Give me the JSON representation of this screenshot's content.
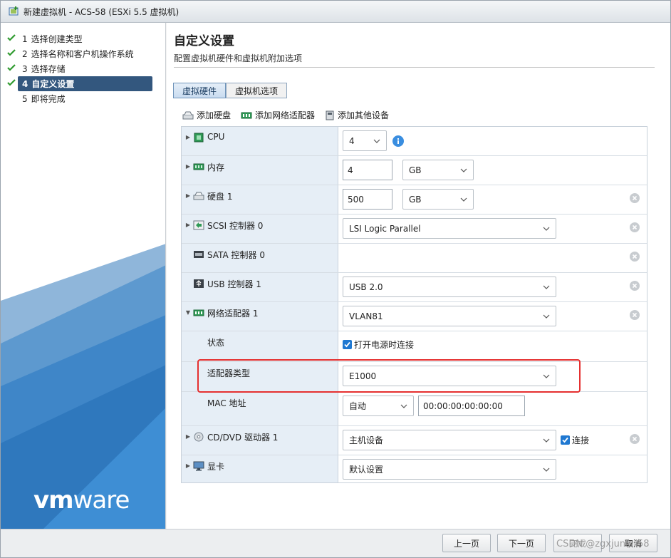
{
  "window": {
    "title": "新建虚拟机 - ACS-58 (ESXi 5.5 虚拟机)"
  },
  "steps": [
    {
      "num": "1",
      "label": "选择创建类型",
      "done": true
    },
    {
      "num": "2",
      "label": "选择名称和客户机操作系统",
      "done": true
    },
    {
      "num": "3",
      "label": "选择存储",
      "done": true
    },
    {
      "num": "4",
      "label": "自定义设置",
      "done": true,
      "active": true
    },
    {
      "num": "5",
      "label": "即将完成",
      "done": false
    }
  ],
  "brand": {
    "logo_vm": "vm",
    "logo_ware": "ware"
  },
  "main": {
    "title": "自定义设置",
    "subtitle": "配置虚拟机硬件和虚拟机附加选项",
    "tabs": [
      {
        "label": "虚拟硬件",
        "active": true
      },
      {
        "label": "虚拟机选项",
        "active": false
      }
    ],
    "toolbar": {
      "add_disk": "添加硬盘",
      "add_nic": "添加网络适配器",
      "add_other": "添加其他设备"
    }
  },
  "hardware": {
    "cpu": {
      "label": "CPU",
      "value": "4"
    },
    "memory": {
      "label": "内存",
      "value": "4",
      "unit": "GB"
    },
    "disk": {
      "label": "硬盘 1",
      "value": "500",
      "unit": "GB"
    },
    "scsi": {
      "label": "SCSI 控制器 0",
      "value": "LSI Logic Parallel"
    },
    "sata": {
      "label": "SATA 控制器 0"
    },
    "usb": {
      "label": "USB 控制器 1",
      "value": "USB 2.0"
    },
    "nic": {
      "label": "网络适配器 1",
      "value": "VLAN81",
      "status_label": "状态",
      "status_value": "打开电源时连接",
      "type_label": "适配器类型",
      "type_value": "E1000",
      "mac_label": "MAC 地址",
      "mac_mode": "自动",
      "mac_value": "00:00:00:00:00:00"
    },
    "cddvd": {
      "label": "CD/DVD 驱动器 1",
      "value": "主机设备",
      "connect_label": "连接"
    },
    "video": {
      "label": "显卡",
      "value": "默认设置"
    }
  },
  "footer": {
    "back": "上一页",
    "next": "下一页",
    "finish": "完成",
    "cancel": "取消",
    "watermark": "CSDN @zgxjunior58"
  },
  "colors": {
    "accent": "#33577e",
    "brand_blue": "#1f78d1",
    "highlight": "#e53030"
  }
}
